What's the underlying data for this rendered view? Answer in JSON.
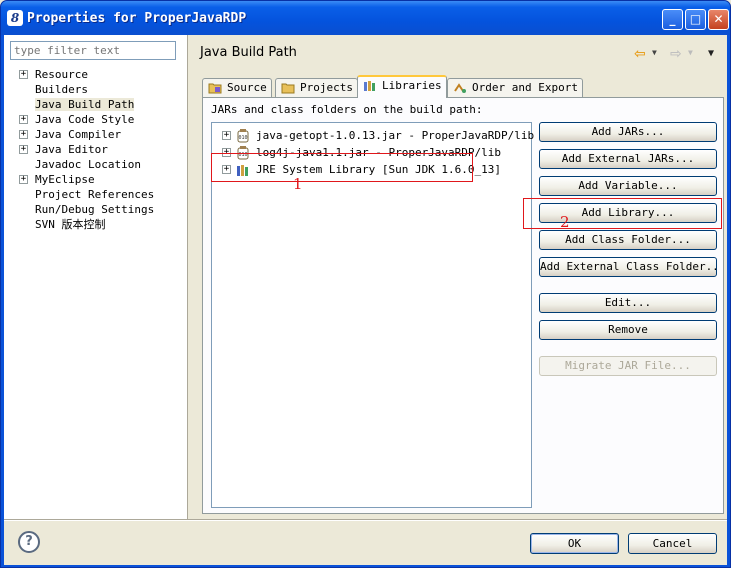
{
  "window": {
    "title": "Properties for ProperJavaRDP",
    "minimize_label": "_",
    "maximize_label": "□",
    "close_label": "✕"
  },
  "filter": {
    "placeholder": "type filter text"
  },
  "nav_tree": [
    {
      "label": "Resource",
      "expandable": true
    },
    {
      "label": "Builders",
      "expandable": false
    },
    {
      "label": "Java Build Path",
      "expandable": false,
      "selected": true
    },
    {
      "label": "Java Code Style",
      "expandable": true
    },
    {
      "label": "Java Compiler",
      "expandable": true
    },
    {
      "label": "Java Editor",
      "expandable": true
    },
    {
      "label": "Javadoc Location",
      "expandable": false
    },
    {
      "label": "MyEclipse",
      "expandable": true
    },
    {
      "label": "Project References",
      "expandable": false
    },
    {
      "label": "Run/Debug Settings",
      "expandable": false
    },
    {
      "label": "SVN 版本控制",
      "expandable": false
    }
  ],
  "page": {
    "title": "Java Build Path"
  },
  "tabs": [
    {
      "label": "Source",
      "icon": "source-folder-icon"
    },
    {
      "label": "Projects",
      "icon": "projects-folder-icon"
    },
    {
      "label": "Libraries",
      "icon": "libraries-icon",
      "active": true
    },
    {
      "label": "Order and Export",
      "icon": "order-export-icon"
    }
  ],
  "libraries": {
    "caption": "JARs and class folders on the build path:",
    "items": [
      {
        "label": "java-getopt-1.0.13.jar - ProperJavaRDP/lib",
        "icon": "jar-icon"
      },
      {
        "label": "log4j-java1.1.jar - ProperJavaRDP/lib",
        "icon": "jar-icon"
      },
      {
        "label": "JRE System Library [Sun JDK 1.6.0_13]",
        "icon": "jre-library-icon"
      }
    ]
  },
  "buttons": {
    "add_jars": "Add JARs...",
    "add_external_jars": "Add External JARs...",
    "add_variable": "Add Variable...",
    "add_library": "Add Library...",
    "add_class_folder": "Add Class Folder...",
    "add_external_class_folder": "Add External Class Folder...",
    "edit": "Edit...",
    "remove": "Remove",
    "migrate_jar": "Migrate JAR File..."
  },
  "annotations": {
    "one": "1",
    "two": "2"
  },
  "dialog": {
    "help": "?",
    "ok": "OK",
    "cancel": "Cancel"
  },
  "colors": {
    "title_bar": "#0453dd",
    "annotation": "#e0171b",
    "tab_highlight": "#ffc83c"
  }
}
